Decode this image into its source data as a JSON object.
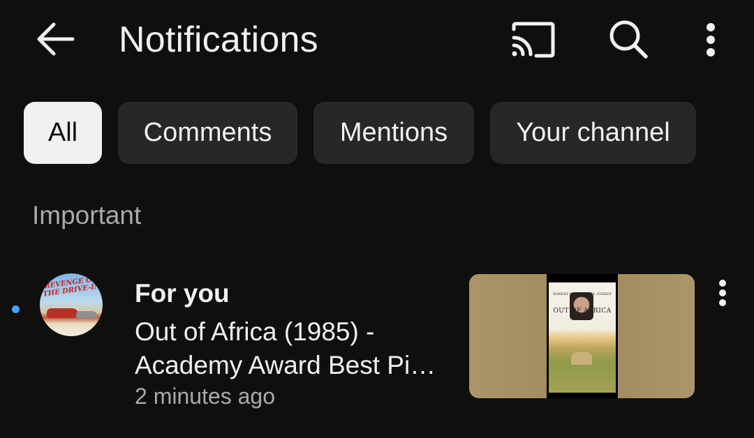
{
  "header": {
    "title": "Notifications",
    "back_icon": "arrow-left-icon",
    "cast_icon": "cast-icon",
    "search_icon": "search-icon",
    "more_icon": "more-vert-icon"
  },
  "chips": [
    {
      "label": "All",
      "active": true
    },
    {
      "label": "Comments",
      "active": false
    },
    {
      "label": "Mentions",
      "active": false
    },
    {
      "label": "Your channel",
      "active": false
    }
  ],
  "section": {
    "label": "Important"
  },
  "notifications": [
    {
      "unread": true,
      "avatar_text": "REVENGE OF THE DRIVE-IN",
      "title": "For you",
      "body_line1": "Out of Africa (1985) -",
      "body_line2": "Academy Award Best Pi…",
      "time": "2 minutes ago",
      "thumbnail_title": "OUT OF AFRICA",
      "thumbnail_names_left": "ROBERT REDFORD",
      "thumbnail_names_right": "MERYL STREEP"
    }
  ],
  "colors": {
    "background": "#0f0f0f",
    "chip_bg": "#272727",
    "chip_active_bg": "#f1f1f1",
    "unread_dot": "#3ea6ff",
    "secondary_text": "#aaaaaa"
  }
}
